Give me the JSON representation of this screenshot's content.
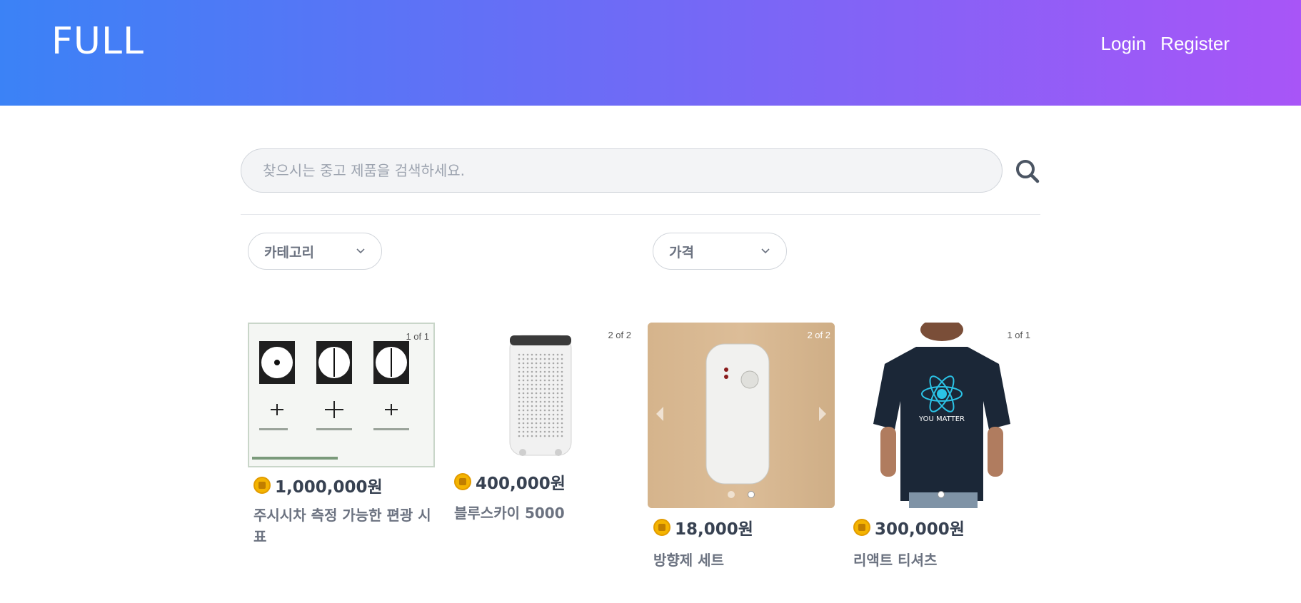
{
  "header": {
    "logo": "FULL",
    "nav": {
      "login": "Login",
      "register": "Register"
    }
  },
  "search": {
    "placeholder": "찾으시는 중고 제품을 검색하세요.",
    "value": "",
    "icon": "search-icon"
  },
  "filters": {
    "category": {
      "label": "카테고리",
      "icon": "chevron-down-icon"
    },
    "price": {
      "label": "가격",
      "icon": "chevron-down-icon"
    }
  },
  "products": [
    {
      "counter": "1 of 1",
      "price": "1,000,000원",
      "title": "주시시차 측정 가능한 편광 시표",
      "image": "diagram-image"
    },
    {
      "counter": "2 of 2",
      "price": "400,000원",
      "title": "블루스카이 5000",
      "image": "air-purifier-image"
    },
    {
      "counter": "2 of 2",
      "price": "18,000원",
      "title": "방향제 세트",
      "image": "air-freshener-image"
    },
    {
      "counter": "1 of 1",
      "price": "300,000원",
      "title": "리액트 티셔츠",
      "image": "tshirt-image",
      "shirt_text": "YOU MATTER"
    }
  ],
  "colors": {
    "gradient_start": "#3b82f6",
    "gradient_end": "#a855f7",
    "coin": "#f4b400"
  }
}
